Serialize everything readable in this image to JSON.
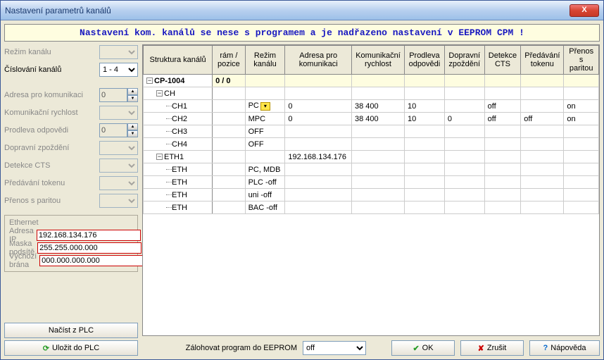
{
  "title": "Nastavení parametrů kanálů",
  "banner": "Nastavení kom. kanálů se nese s programem a je nadřazeno nastavení v EEPROM CPM !",
  "left": {
    "rezim_kanal": "Režim kanálu",
    "cislovani": "Číslování kanálů",
    "cislovani_val": "1 - 4",
    "adresa_kom": "Adresa pro komunikaci",
    "adresa_kom_val": "0",
    "kom_rych": "Komunikační rychlost",
    "prodleva": "Prodleva odpovědi",
    "prodleva_val": "0",
    "dopravni": "Dopravní zpoždění",
    "detekce": "Detekce CTS",
    "predavani": "Předávání tokenu",
    "prenos": "Přenos s paritou",
    "ethernet": "Ethernet",
    "ip": "Adresa IP",
    "ip_val": "192.168.134.176",
    "mask": "Maska podsítě",
    "mask_val": "255.255.000.000",
    "gate": "Výchozí brána",
    "gate_val": "000.000.000.000",
    "load": "Načíst z PLC",
    "save": "Uložit do PLC"
  },
  "headers": {
    "h0": "Struktura kanálů",
    "h1": "rám / pozice",
    "h2": "Režim kanálu",
    "h3": "Adresa pro komunikaci",
    "h4": "Komunikační rychlost",
    "h5": "Prodleva odpovědi",
    "h6": "Dopravní zpoždění",
    "h7": "Detekce CTS",
    "h8": "Předávání tokenu",
    "h9": "Přenos s paritou"
  },
  "rows": {
    "r0": {
      "name": "CP-1004",
      "pos": "0 / 0"
    },
    "r1": {
      "name": "CH"
    },
    "r2": {
      "name": "CH1",
      "mode": "PC",
      "addr": "0",
      "speed": "38 400",
      "delay": "10",
      "cts": "off",
      "par": "on"
    },
    "r3": {
      "name": "CH2",
      "mode": "MPC",
      "addr": "0",
      "speed": "38 400",
      "delay": "10",
      "trans": "0",
      "cts": "off",
      "tok": "off",
      "par": "on"
    },
    "r4": {
      "name": "CH3",
      "mode": "OFF"
    },
    "r5": {
      "name": "CH4",
      "mode": "OFF"
    },
    "r6": {
      "name": "ETH1",
      "addr": "192.168.134.176"
    },
    "r7": {
      "name": "ETH",
      "mode": "PC, MDB"
    },
    "r8": {
      "name": "ETH",
      "mode": "PLC -off"
    },
    "r9": {
      "name": "ETH",
      "mode": "uni -off"
    },
    "r10": {
      "name": "ETH",
      "mode": "BAC -off"
    }
  },
  "bottom": {
    "backup": "Zálohovat program do EEPROM",
    "backup_val": "off",
    "ok": "OK",
    "cancel": "Zrušit",
    "help": "Nápověda"
  }
}
